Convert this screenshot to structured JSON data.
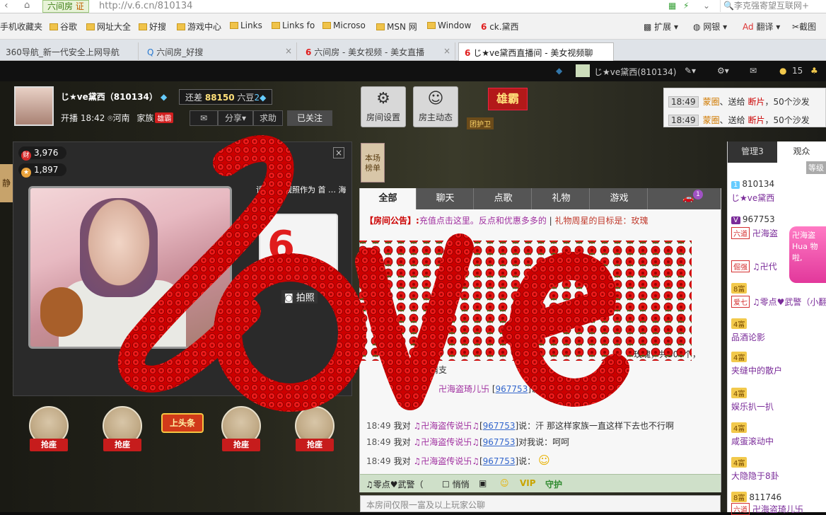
{
  "browser": {
    "site_tag": "六间房",
    "cert": "证",
    "url": "http://v.6.cn/810134",
    "search_placeholder": "李克强寄望互联网+",
    "favorites": [
      "手机收藏夹",
      "谷歌",
      "网址大全",
      "好搜",
      "游戏中心",
      "Links",
      "Links fo",
      "Microso",
      "MSN 网",
      "Window",
      "ck.黛西"
    ],
    "tabs": [
      {
        "label": "360导航_新一代安全上网导航"
      },
      {
        "label": "六间房_好搜"
      },
      {
        "label": "六间房 - 美女视频 - 美女直播"
      },
      {
        "label": "じ★ve黛西直播间 - 美女视频聊"
      }
    ],
    "ext": [
      "扩展",
      "网银",
      "翻译",
      "截图"
    ]
  },
  "topstrip": {
    "user": "じ★ve黛西(810134)",
    "coins": "15"
  },
  "host": {
    "name": "じ★ve黛西（810134）",
    "diff_prefix": "还差",
    "diff_value": "88150",
    "diff_suffix": "六豆",
    "live_label": "开播",
    "live_time": "18:42",
    "location": "河南",
    "family_label": "家族",
    "family_badge": "雄霸",
    "share": "分享",
    "help": "求助",
    "followed": "已关注"
  },
  "buttons": {
    "room_settings": "房间设置",
    "host_news": "房主动态",
    "xiongba": "雄霸",
    "guard": "团护卫"
  },
  "gift_feed": [
    {
      "time": "18:49",
      "user": "蒙圈",
      "action": "送给",
      "target": "断片",
      "count": "50个沙发"
    },
    {
      "time": "18:49",
      "user": "蒙圈",
      "action": "送给",
      "target": "断片",
      "count": "50个沙发"
    }
  ],
  "stats": {
    "wealth": "3,976",
    "fans": "1,897"
  },
  "side_tab": "静",
  "poster_text": "请护 … 靓照作为 首 … 海报",
  "snap": "拍照",
  "seats": [
    "抢座",
    "抢座",
    "抢座",
    "抢座"
  ],
  "headline": "上头条",
  "rank_btn": "本场榜单",
  "chat": {
    "tabs": [
      "全部",
      "聊天",
      "点歌",
      "礼物",
      "游戏"
    ],
    "car_badge": "1",
    "notice_label": "【房间公告】:",
    "notice_text": "充值点击这里。反点和优惠多多的",
    "notice_tail": "礼物周星的目标是：玫瑰",
    "messages": [
      {
        "time": "",
        "user": "",
        "id": "",
        "text": "玫瑰，共300个，"
      },
      {
        "time": "",
        "user": "卍海盗",
        "id": "",
        "text": "的热情支"
      },
      {
        "time": "",
        "user": "卍海盗琦儿卐",
        "id": "967753",
        "text": "说：说把；受泡"
      },
      {
        "time": "18:49",
        "user": "♫卍海盗传说卐♫",
        "id": "967753",
        "text": "说：汗 那这样家族一直这样下去也不行啊",
        "prefix": "我对"
      },
      {
        "time": "18:49",
        "user": "♫卍海盗传说卐♫",
        "id": "967753",
        "text": "对我说：呵呵",
        "prefix": "我对"
      },
      {
        "time": "18:49",
        "user": "♫卍海盗传说卐♫",
        "id": "967753",
        "text": "说：",
        "prefix": "我对"
      }
    ],
    "target": "♫零点♥武警（",
    "whisper": "悄悄",
    "input_hint": "本房间仅限一富及以上玩家公聊"
  },
  "users": {
    "tab_manage": "管理3",
    "tab_audience": "观众",
    "level_label": "等级",
    "rows": [
      {
        "lv": "1",
        "text": "810134"
      },
      {
        "lv": "",
        "text": "じ★ve黛西"
      },
      {
        "lv": "",
        "text": "967753"
      },
      {
        "lv": "",
        "text": "卍海盗"
      },
      {
        "lv": "",
        "text": "♫卍代"
      },
      {
        "lv": "8富",
        "text": ""
      },
      {
        "lv": "",
        "text": "♫零点♥武警（小翻"
      },
      {
        "lv": "4富",
        "text": ""
      },
      {
        "lv": "",
        "text": "品酒论影"
      },
      {
        "lv": "4富",
        "text": ""
      },
      {
        "lv": "",
        "text": "夹缝中的散户"
      },
      {
        "lv": "4富",
        "text": ""
      },
      {
        "lv": "",
        "text": "娱乐扒一扒"
      },
      {
        "lv": "4富",
        "text": ""
      },
      {
        "lv": "",
        "text": "咸蛋滚动中"
      },
      {
        "lv": "4富",
        "text": ""
      },
      {
        "lv": "",
        "text": "大隐隐于8卦"
      },
      {
        "lv": "8富",
        "text": "811746"
      },
      {
        "lv": "",
        "text": "卍海盗琦儿卐"
      }
    ],
    "ad": "卍海盗 Hua 物啦,"
  },
  "colors": {
    "accent_red": "#e01010",
    "chat_purple": "#a030a0",
    "id_blue": "#3366cc"
  }
}
